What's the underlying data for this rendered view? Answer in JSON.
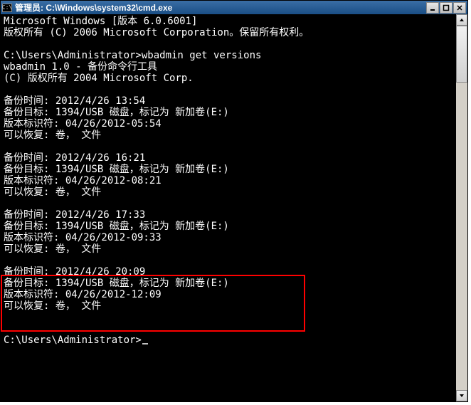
{
  "titlebar": {
    "icon_text": "C:\\",
    "title": "管理员: C:\\Windows\\system32\\cmd.exe"
  },
  "terminal": {
    "line01": "Microsoft Windows [版本 6.0.6001]",
    "line02": "版权所有 (C) 2006 Microsoft Corporation。保留所有权利。",
    "line03": "",
    "line04": "C:\\Users\\Administrator>wbadmin get versions",
    "line05": "wbadmin 1.0 - 备份命令行工具",
    "line06": "(C) 版权所有 2004 Microsoft Corp.",
    "line07": "",
    "line08": "备份时间: 2012/4/26 13:54",
    "line09": "备份目标: 1394/USB 磁盘，标记为 新加卷(E:)",
    "line10": "版本标识符: 04/26/2012-05:54",
    "line11": "可以恢复: 卷， 文件",
    "line12": "",
    "line13": "备份时间: 2012/4/26 16:21",
    "line14": "备份目标: 1394/USB 磁盘，标记为 新加卷(E:)",
    "line15": "版本标识符: 04/26/2012-08:21",
    "line16": "可以恢复: 卷， 文件",
    "line17": "",
    "line18": "备份时间: 2012/4/26 17:33",
    "line19": "备份目标: 1394/USB 磁盘，标记为 新加卷(E:)",
    "line20": "版本标识符: 04/26/2012-09:33",
    "line21": "可以恢复: 卷， 文件",
    "line22": "",
    "line23": "备份时间: 2012/4/26 20:09",
    "line24": "备份目标: 1394/USB 磁盘，标记为 新加卷(E:)",
    "line25": "版本标识符: 04/26/2012-12:09",
    "line26": "可以恢复: 卷， 文件",
    "line27": "",
    "line28": "",
    "line29": "C:\\Users\\Administrator>"
  }
}
